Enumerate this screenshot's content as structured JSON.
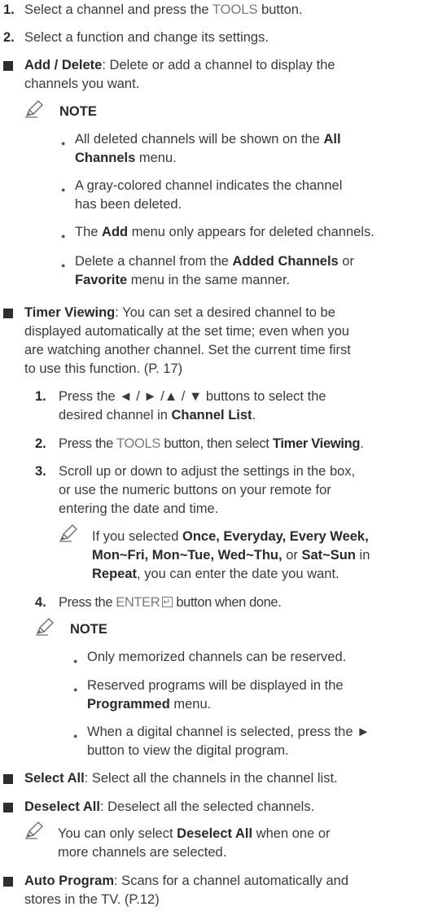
{
  "steps": [
    {
      "num": "1.",
      "before": "Select a channel and press the ",
      "key": "TOOLS",
      "after": " button."
    },
    {
      "num": "2.",
      "text": "Select a function and change its settings."
    }
  ],
  "add_delete": {
    "title": "Add / Delete",
    "l1": ": Delete or add a channel to display the",
    "l2": "channels you want.",
    "note_label": "NOTE",
    "bullets": {
      "b1_pre": "All deleted channels will be shown on the ",
      "b1_bold1": "All",
      "b1_bold2": "Channels",
      "b1_post": " menu.",
      "b2_l1": "A gray-colored channel indicates the channel",
      "b2_l2": "has been deleted.",
      "b3_pre": "The ",
      "b3_bold": "Add",
      "b3_post": " menu only appears for deleted channels.",
      "b4_pre": "Delete a channel from the ",
      "b4_bold1": "Added Channels",
      "b4_mid": " or",
      "b4_bold2": "Favorite",
      "b4_post": " menu in the same manner."
    }
  },
  "timer": {
    "title": "Timer Viewing",
    "l1": ": You can set a desired channel to be",
    "l2": "displayed automatically at the set time; even when you",
    "l3": "are watching another channel. Set the current time first",
    "l4": "to use this function. (P. 17)",
    "s1_num": "1.",
    "s1_l1": "Press the ◄ / ► /▲ / ▼ buttons to select the",
    "s1_l2_pre": "desired channel in ",
    "s1_l2_bold": "Channel List",
    "s1_l2_post": ".",
    "s2_num": "2.",
    "s2_pre": "Press the ",
    "s2_key": "TOOLS",
    "s2_mid": " button, then select ",
    "s2_bold": "Timer Viewing",
    "s2_post": ".",
    "s3_num": "3.",
    "s3_l1": "Scroll up or down to adjust the settings in the box,",
    "s3_l2": "or use the numeric buttons on your remote for",
    "s3_l3": "entering the date and time.",
    "s3_note_pre": "If you selected ",
    "s3_note_b1": "Once, Everyday, Every Week,",
    "s3_note_b2": "Mon~Fri, Mon~Tue, Wed~Thu,",
    "s3_note_or": " or ",
    "s3_note_b3": "Sat~Sun",
    "s3_note_in": " in",
    "s3_note_b4": "Repeat",
    "s3_note_post": ", you can enter the date you want.",
    "s4_num": "4.",
    "s4_pre": "Press the ",
    "s4_key": "ENTER",
    "s4_post": " button when done.",
    "note_label": "NOTE",
    "n1": "Only memorized channels can be reserved.",
    "n2_l1": "Reserved programs will be displayed in the",
    "n2_bold": "Programmed",
    "n2_post": " menu.",
    "n3_l1": "When a digital channel is selected, press the ►",
    "n3_l2": "button to view the digital program."
  },
  "select_all": {
    "title": "Select All",
    "text": ": Select all the channels in the channel list."
  },
  "deselect_all": {
    "title": "Deselect All",
    "text": ": Deselect all the selected channels.",
    "note_pre": "You can only select ",
    "note_bold": "Deselect All",
    "note_post": " when one or",
    "note_l2": "more channels are selected."
  },
  "auto_program": {
    "title": "Auto Program",
    "l1": ": Scans for a channel automatically and",
    "l2": "stores in the TV. (P.12)"
  },
  "icons": {
    "bullet_square": "square-bullet-icon",
    "note": "pencil-note-icon",
    "enter": "enter-key-icon"
  }
}
